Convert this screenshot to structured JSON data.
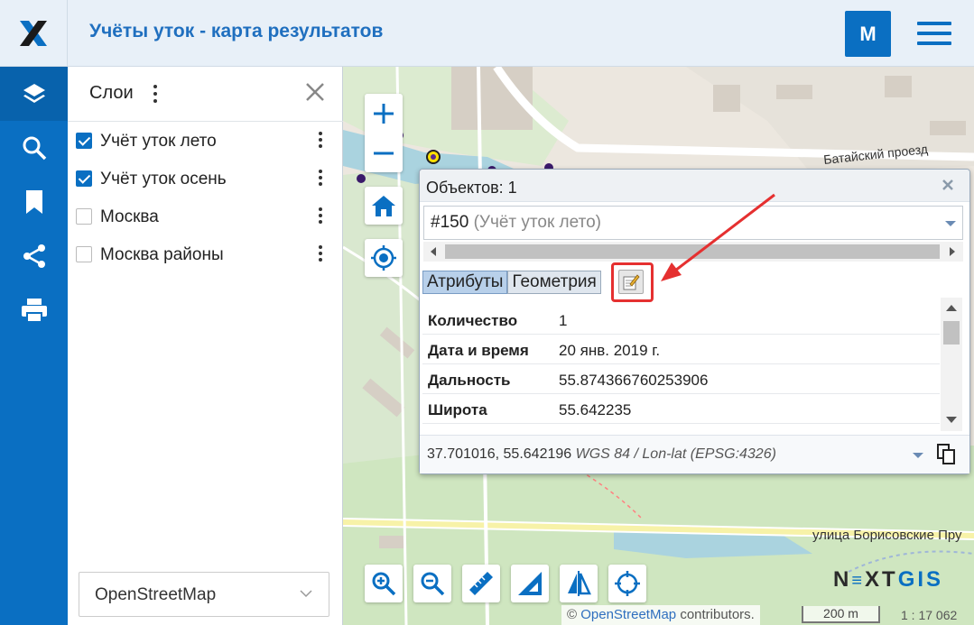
{
  "header": {
    "title": "Учёты уток - карта результатов",
    "user_initial": "M"
  },
  "colors": {
    "brand": "#0a6fc2",
    "highlight": "#e53030"
  },
  "sidebar_tools": [
    {
      "icon": "layers-icon"
    },
    {
      "icon": "search-icon"
    },
    {
      "icon": "bookmark-icon"
    },
    {
      "icon": "share-icon"
    },
    {
      "icon": "print-icon"
    }
  ],
  "layers_panel": {
    "title": "Слои",
    "layers": [
      {
        "label": "Учёт уток лето",
        "checked": true
      },
      {
        "label": "Учёт уток осень",
        "checked": true
      },
      {
        "label": "Москва",
        "checked": false
      },
      {
        "label": "Москва районы",
        "checked": false
      }
    ],
    "basemap": "OpenStreetMap"
  },
  "map": {
    "street_labels": [
      "Батайский проезд",
      "улица Борисовские Пру"
    ],
    "brand": {
      "part1": "N",
      "part2": "XT",
      "part3": "GIS"
    },
    "attribution_prefix": "©",
    "attribution_link": "OpenStreetMap",
    "attribution_suffix": "contributors.",
    "scale": "200 m",
    "scale_ratio": "1 : 17 062"
  },
  "popup": {
    "count_label": "Объектов: 1",
    "feature_id": "#150",
    "feature_layer": "(Учёт уток лето)",
    "tabs": [
      {
        "label": "Атрибуты",
        "active": true
      },
      {
        "label": "Геометрия",
        "active": false
      }
    ],
    "attributes": [
      {
        "key": "Количество",
        "value": "1"
      },
      {
        "key": "Дата и время",
        "value": "20 янв. 2019 г."
      },
      {
        "key": "Дальность",
        "value": "55.874366760253906"
      },
      {
        "key": "Широта",
        "value": "55.642235"
      }
    ],
    "coords": "37.701016, 55.642196",
    "crs": "WGS 84 / Lon-lat (EPSG:4326)"
  }
}
